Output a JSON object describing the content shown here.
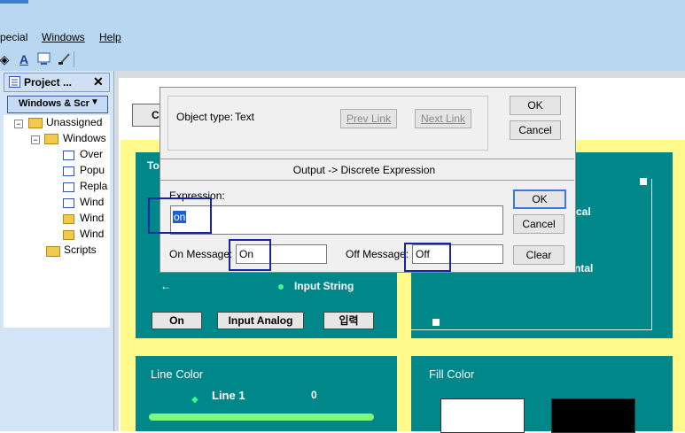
{
  "menu": {
    "items": [
      "pecial",
      "Windows",
      "Help"
    ]
  },
  "toolbar": {
    "icons": [
      "paint-bucket-icon",
      "text-a-icon",
      "monitor-icon",
      "brush-icon"
    ],
    "text_label": "A"
  },
  "project_panel": {
    "title": "Project ...",
    "close": "✕",
    "tab": "Windows & Scr",
    "tree": {
      "unassigned": "Unassigned",
      "windows": "Windows",
      "items": [
        "Over",
        "Popu",
        "Repla",
        "Wind",
        "Wind",
        "Wind"
      ],
      "scripts": "Scripts"
    }
  },
  "background": {
    "panel1_title": "To",
    "input_string": "Input String",
    "arrow": "←",
    "btn_on": "On",
    "btn_input_analog": "Input Analog",
    "btn_korean": "입력",
    "panel2_vertical": "cal",
    "panel2_horizontal": "ntal",
    "line_color": "Line Color",
    "line1": "Line 1",
    "line1_value": "0",
    "fill_color": "Fill Color",
    "btn_behind": "C"
  },
  "dialog": {
    "object_type_label": "Object type:",
    "object_type_value": "Text",
    "prev_link": "Prev Link",
    "next_link": "Next Link",
    "ok_top": "OK",
    "cancel_top": "Cancel",
    "section_title": "Output -> Discrete Expression",
    "expression_label": "Expression:",
    "expression_value": "on",
    "ok": "OK",
    "cancel": "Cancel",
    "on_message_label": "On Message:",
    "on_message_value": "On",
    "off_message_label": "Off Message:",
    "off_message_value": "Off",
    "clear": "Clear"
  },
  "colors": {
    "panel_teal": "#00878a",
    "frame_yellow": "#fff98c",
    "highlight_blue": "#1226a6",
    "default_button": "#3b78d8"
  }
}
